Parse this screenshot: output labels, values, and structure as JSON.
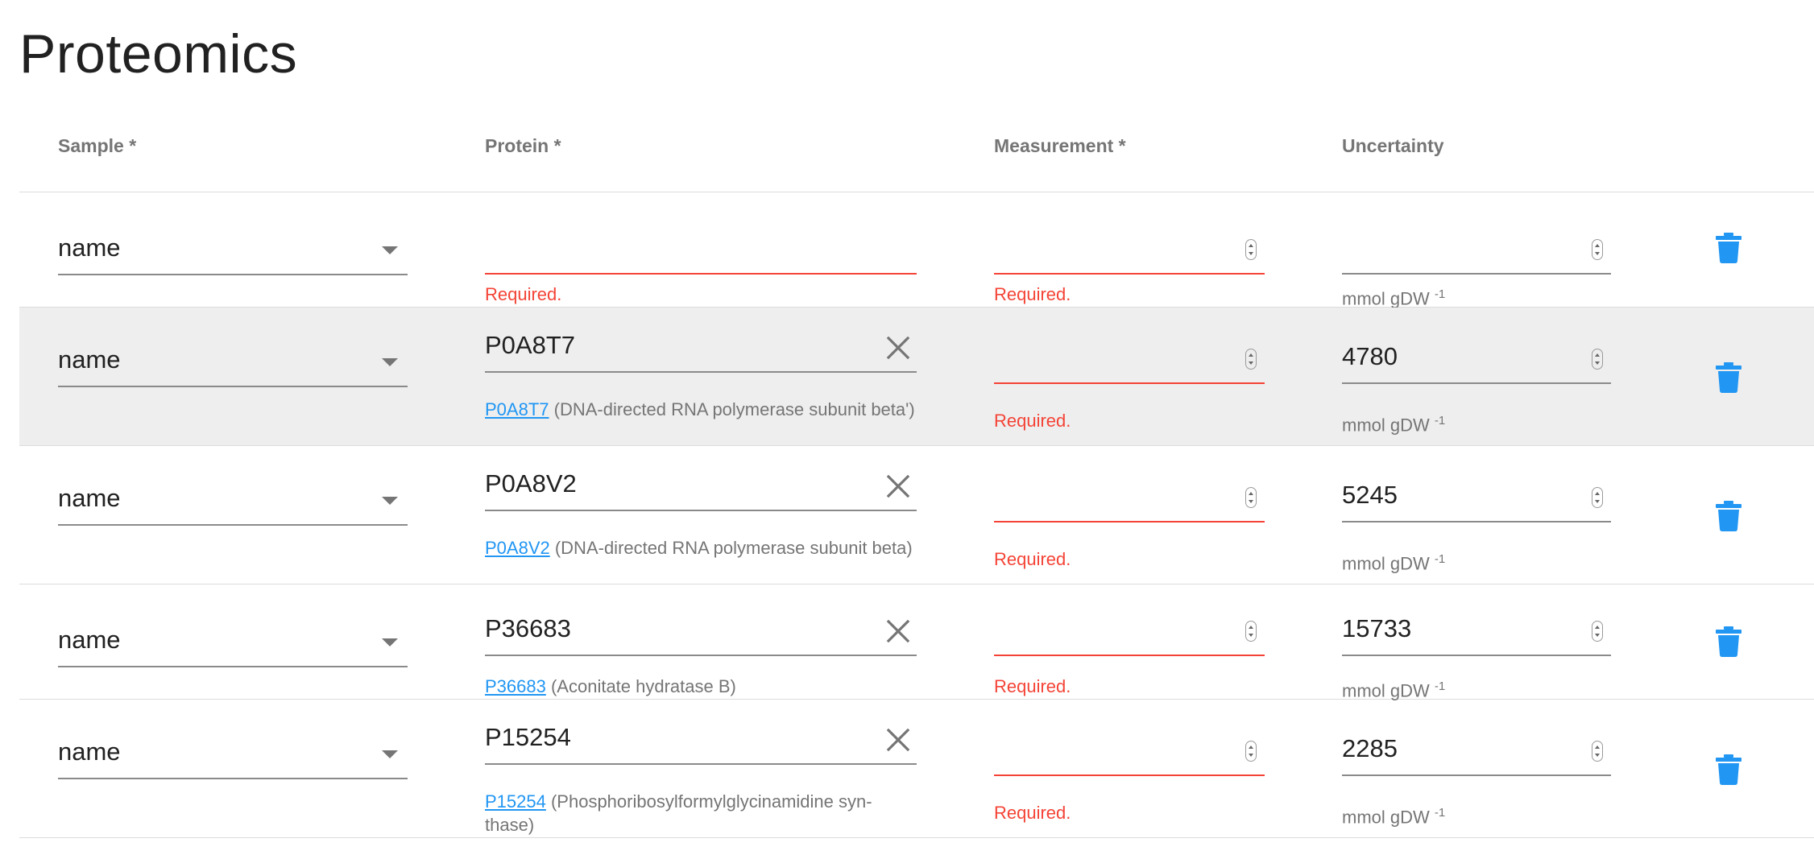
{
  "page": {
    "title": "Proteomics"
  },
  "columns": {
    "sample": "Sample *",
    "protein": "Protein *",
    "measurement": "Measurement *",
    "uncertainty": "Uncertainty"
  },
  "validation": {
    "required": "Required."
  },
  "units": {
    "base": "mmol gDW",
    "exp": "-1"
  },
  "rows": [
    {
      "sample": "name",
      "protein": "",
      "protein_link": "",
      "protein_desc": "",
      "measurement": "",
      "uncertainty": ""
    },
    {
      "sample": "name",
      "protein": "P0A8T7",
      "protein_link": "P0A8T7",
      "protein_desc": " (DNA-directed RNA polymerase subunit beta')",
      "measurement": "",
      "uncertainty": "4780"
    },
    {
      "sample": "name",
      "protein": "P0A8V2",
      "protein_link": "P0A8V2",
      "protein_desc": " (DNA-directed RNA polymerase subunit beta)",
      "measurement": "",
      "uncertainty": "5245"
    },
    {
      "sample": "name",
      "protein": "P36683",
      "protein_link": "P36683",
      "protein_desc": " (Aconitate hydratase B)",
      "measurement": "",
      "uncertainty": "15733"
    },
    {
      "sample": "name",
      "protein": "P15254",
      "protein_link": "P15254",
      "protein_desc": " (Phosphoribosylformylglycinamidine syn-thase)",
      "measurement": "",
      "uncertainty": "2285"
    }
  ],
  "icons": {
    "sample_caret": "caret-down-icon",
    "protein_clear": "close-icon",
    "spinner": "spinner-icon",
    "delete": "trash-icon"
  },
  "colors": {
    "error": "#f44336",
    "link": "#2196f3",
    "delete_icon": "#2196f3",
    "highlight_row": "#eeeeee"
  }
}
